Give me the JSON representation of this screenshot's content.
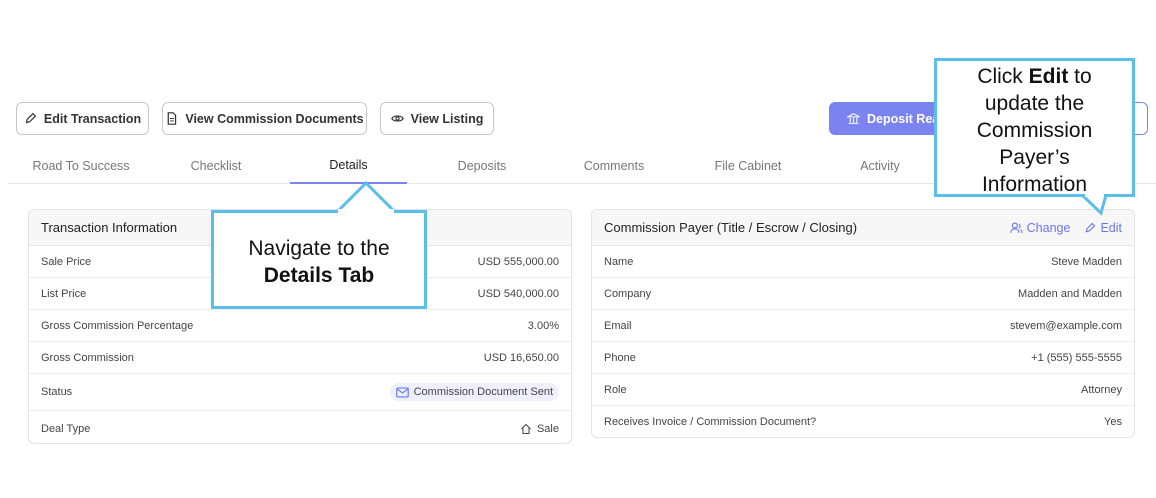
{
  "toolbar": {
    "edit_transaction": "Edit Transaction",
    "view_commission_documents": "View Commission Documents",
    "view_listing": "View Listing",
    "deposit": "Deposit Real"
  },
  "tabs": [
    "Road To Success",
    "Checklist",
    "Details",
    "Deposits",
    "Comments",
    "File Cabinet",
    "Activity"
  ],
  "transaction": {
    "title": "Transaction Information",
    "rows": [
      {
        "label": "Sale Price",
        "value": "USD 555,000.00"
      },
      {
        "label": "List Price",
        "value": "USD 540,000.00"
      },
      {
        "label": "Gross Commission Percentage",
        "value": "3.00%"
      },
      {
        "label": "Gross Commission",
        "value": "USD 16,650.00"
      },
      {
        "label": "Status",
        "value": "Commission Document Sent"
      },
      {
        "label": "Deal Type",
        "value": "Sale"
      }
    ]
  },
  "payer": {
    "title": "Commission Payer (Title / Escrow / Closing)",
    "change_label": "Change",
    "edit_label": "Edit",
    "rows": [
      {
        "label": "Name",
        "value": "Steve Madden"
      },
      {
        "label": "Company",
        "value": "Madden and Madden"
      },
      {
        "label": "Email",
        "value": "stevem@example.com"
      },
      {
        "label": "Phone",
        "value": "+1 (555) 555-5555"
      },
      {
        "label": "Role",
        "value": "Attorney"
      },
      {
        "label": "Receives Invoice / Commission Document?",
        "value": "Yes"
      }
    ]
  },
  "callouts": {
    "details": {
      "line1": "Navigate to the",
      "bold": "Details Tab"
    },
    "edit": {
      "pre": "Click ",
      "bold": "Edit",
      "post": " to",
      "line2": "update the",
      "line3": "Commission",
      "line4": "Payer’s",
      "line5": "Information"
    }
  },
  "colors": {
    "accent": "#7b83f0",
    "callout_border": "#5bbde9"
  }
}
